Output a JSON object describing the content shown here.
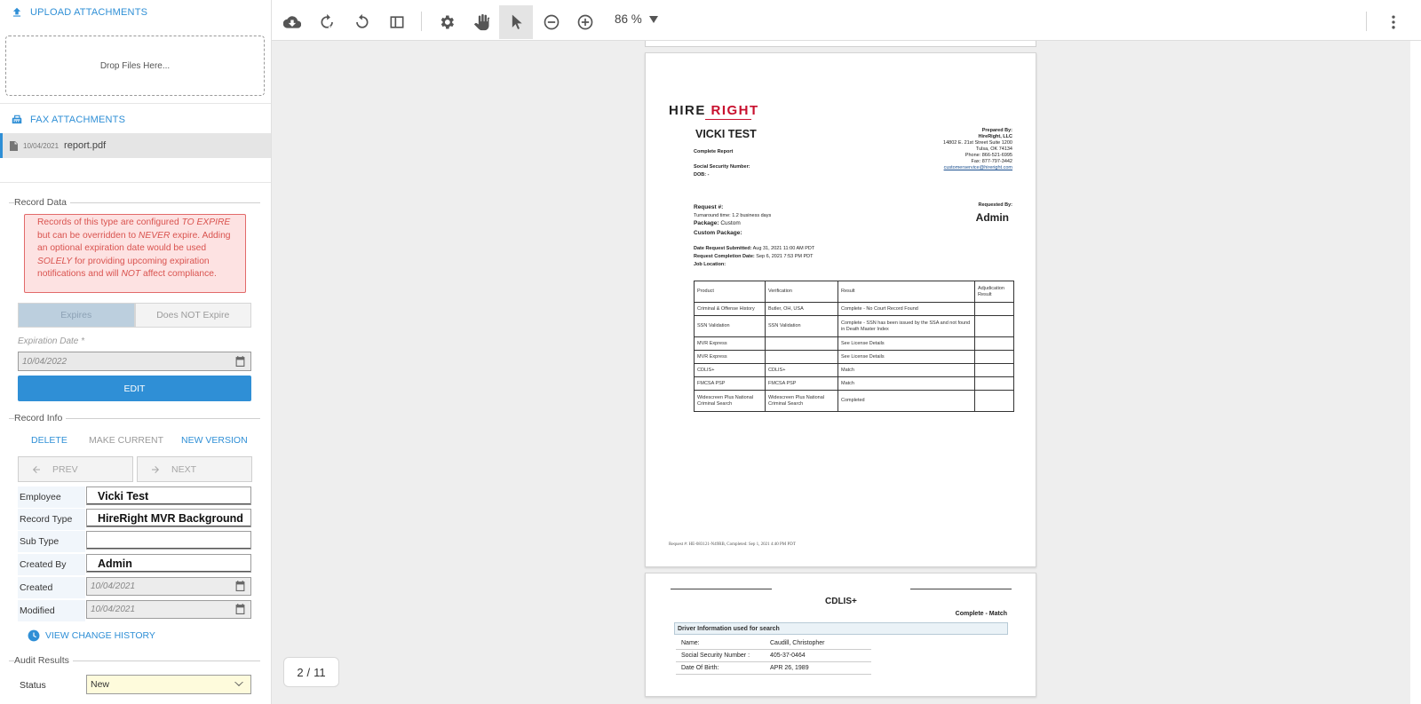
{
  "sidebar": {
    "upload_label": "UPLOAD ATTACHMENTS",
    "drop_text": "Drop Files Here...",
    "fax_label": "FAX ATTACHMENTS",
    "file": {
      "date": "10/04/2021",
      "name": "report.pdf"
    },
    "record_data": {
      "legend": "Record Data",
      "warning": {
        "p1": "Records of this type are configured ",
        "em1": "TO EXPIRE",
        "p2": " but can be overridden to ",
        "em2": "NEVER",
        "p3": " expire. Adding an optional expiration date would be used ",
        "em3": "SOLELY",
        "p4": " for providing upcoming expiration notifications and will ",
        "em4": "NOT",
        "p5": " affect compliance."
      },
      "expires_label": "Expires",
      "not_expire_label": "Does NOT Expire",
      "expiration_label": "Expiration Date *",
      "expiration_value": "10/04/2022",
      "edit_label": "EDIT"
    },
    "record_info": {
      "legend": "Record Info",
      "delete_label": "DELETE",
      "make_current_label": "MAKE CURRENT",
      "new_version_label": "NEW VERSION",
      "prev_label": "PREV",
      "next_label": "NEXT",
      "fields": {
        "employee_label": "Employee",
        "employee_value": "Vicki Test",
        "record_type_label": "Record Type",
        "record_type_value": "HireRight MVR Background",
        "sub_type_label": "Sub Type",
        "sub_type_value": "",
        "created_by_label": "Created By",
        "created_by_value": "Admin",
        "created_label": "Created",
        "created_value": "10/04/2021",
        "modified_label": "Modified",
        "modified_value": "10/04/2021"
      },
      "history_label": "VIEW CHANGE HISTORY"
    },
    "audit_results": {
      "legend": "Audit Results",
      "status_label": "Status",
      "status_value": "New"
    }
  },
  "viewer": {
    "zoom": "86 %",
    "current_page": "2",
    "total_pages": "11",
    "page2": {
      "logo_a": "HIRE",
      "logo_b": "RIGHT",
      "name": "VICKI TEST",
      "complete_report": "Complete Report",
      "ssn_label": "Social Security Number:",
      "dob_label": "DOB: -",
      "prepared_by": [
        "Prepared By:",
        "HireRight, LLC",
        "14802 E. 21st Street Suite 1200",
        "Tulsa, OK 74134",
        "Phone: 866-521-6995",
        "Fax: 877-797-3442",
        "customerservice@hireright.com"
      ],
      "request_label": "Request #:",
      "turnaround": "Turnaround time: 1.2 business days",
      "package_label": "Package:",
      "package_value": "Custom",
      "custom_package_label": "Custom Package:",
      "requested_by_label": "Requested By:",
      "requested_by_value": "Admin",
      "date_submitted_label": "Date Request Submitted:",
      "date_submitted_value": "Aug 31, 2021 11:00 AM PDT",
      "completion_label": "Request Completion Date:",
      "completion_value": "Sep 6, 2021 7:53 PM PDT",
      "job_location_label": "Job Location:",
      "table_headers": [
        "Product",
        "Verification",
        "Result",
        "Adjudication Result"
      ],
      "table_rows": [
        [
          "Criminal & Offense History",
          "Butler, OH, USA",
          "Complete - No Court Record Found",
          ""
        ],
        [
          "SSN Validation",
          "SSN Validation",
          "Complete - SSN has been issued by the SSA and not found in Death Master Index",
          ""
        ],
        [
          "MVR Express",
          "",
          "See License Details",
          ""
        ],
        [
          "MVR Express",
          "",
          "See License Details",
          ""
        ],
        [
          "CDLIS+",
          "CDLIS+",
          "Match",
          ""
        ],
        [
          "FMCSA PSP",
          "FMCSA PSP",
          "Match",
          ""
        ],
        [
          "Widescreen Plus National Criminal Search",
          "Widescreen Plus National Criminal Search",
          "Completed",
          ""
        ]
      ],
      "footer": "Request #: HE-083121-N49RB, Completed: Sep 1, 2021 4:40 PM PDT"
    },
    "page3": {
      "title": "CDLIS+",
      "status": "Complete - Match",
      "driver_info": "Driver Information used for search",
      "name_label": "Name:",
      "name_value": "Caudill, Christopher",
      "ssn_label": "Social Security Number :",
      "ssn_value": "405-37-0464",
      "dob_label": "Date Of Birth:",
      "dob_value": "APR 26, 1989"
    }
  },
  "colors": {
    "accent": "#2f8fd6",
    "warning": "#d9534f",
    "warning_bg": "#fde2e2",
    "brand_red": "#c8102e"
  },
  "icons": [
    "upload-icon",
    "fax-icon",
    "pdf-file-icon",
    "calendar-icon",
    "arrow-left-icon",
    "arrow-right-icon",
    "history-clock-icon",
    "chevron-down-icon",
    "cloud-download-icon",
    "rotate-cw-icon",
    "rotate-ccw-icon",
    "sidebar-toggle-icon",
    "settings-icon",
    "hand-pan-icon",
    "pointer-icon",
    "zoom-out-icon",
    "zoom-in-icon",
    "more-vert-icon"
  ]
}
